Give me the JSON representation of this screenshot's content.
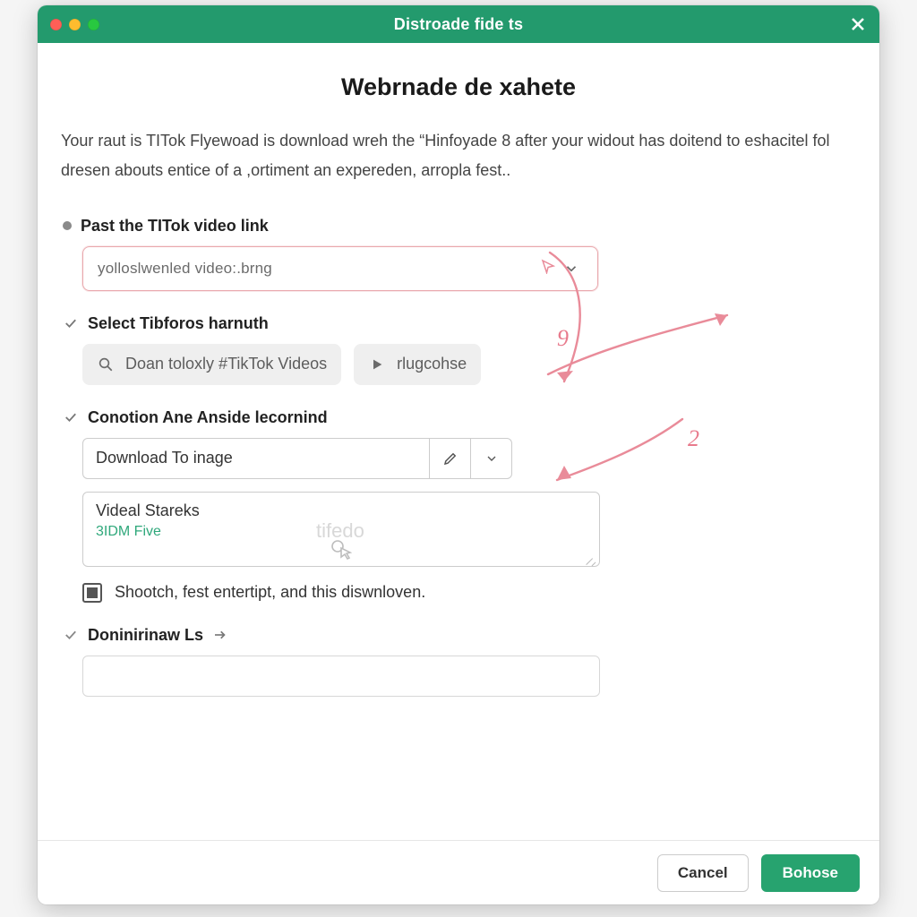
{
  "titlebar": {
    "title": "Distroade fide ts"
  },
  "page": {
    "heading": "Webrnade de xahete",
    "intro": "Your raut is TITok Flyewoad is download wreh the “Hinfoyade 8 after your widout has doitend to eshacitel fol dresen abouts entice of a ,ortiment an expereden, arropla fest.."
  },
  "step1": {
    "label": "Past the TITok video link",
    "value": "yolloslwenled video:.brng"
  },
  "step2": {
    "label": "Select Tibforos harnuth",
    "pill_search": "Doan toloxly #TikTok Videos",
    "pill_play": "rlugcohse"
  },
  "step3": {
    "label": "Conotion Ane Anside lecornind",
    "select_value": "Download To inage",
    "textarea_line1": "Videal Stareks",
    "textarea_line2": "3IDM Five",
    "textarea_watermark": "tifedo",
    "checkbox_label": "Shootch, fest entertipt, and this diswnloven."
  },
  "step4": {
    "label": "Doninirinaw Ls"
  },
  "footer": {
    "cancel": "Cancel",
    "primary": "Bohose"
  },
  "annotations": {
    "num1": "9",
    "num2": "2"
  }
}
